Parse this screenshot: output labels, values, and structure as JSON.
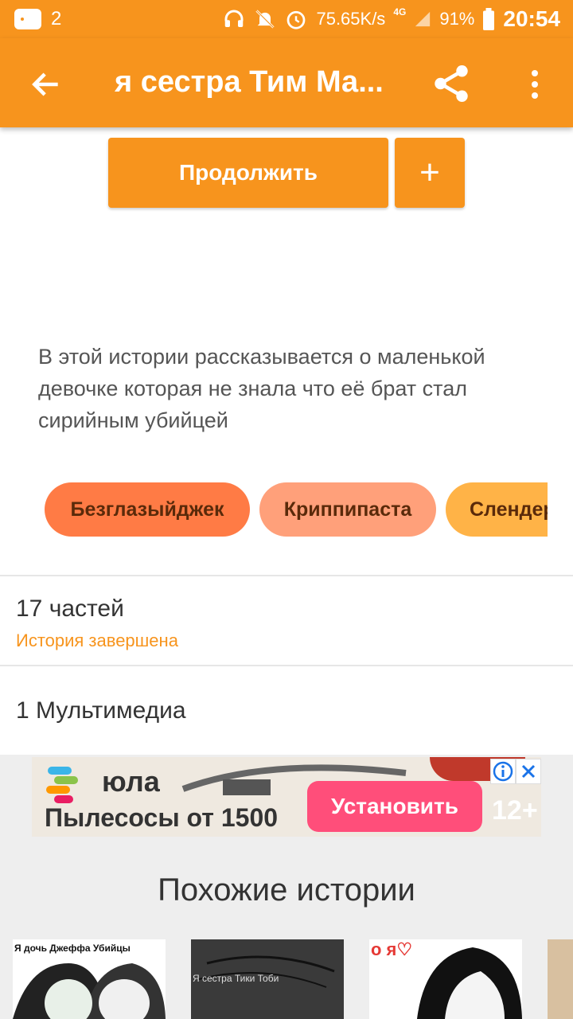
{
  "status_bar": {
    "notification_count": "2",
    "network_speed": "75.65K/s",
    "network_type": "4G",
    "battery": "91%",
    "time": "20:54"
  },
  "app_bar": {
    "title": "я сестра Тим Ма...",
    "back_icon": "arrow-back-icon",
    "share_icon": "share-icon",
    "more_icon": "more-vert-icon"
  },
  "actions": {
    "continue_label": "Продолжить",
    "add_label": "+"
  },
  "description": "В этой истории рассказывается о маленькой девочке которая не знала что её брат стал сирийным убийцей",
  "tags": [
    "Безглазыйджек",
    "Криппипаста",
    "Слендерм"
  ],
  "info": {
    "parts": "17 частей",
    "status": "История завершена",
    "media": "1 Мультимедиа"
  },
  "ad": {
    "brand": "юла",
    "text": "Пылесосы от 1500",
    "install_label": "Установить",
    "age": "12+",
    "info_icon": "info-icon",
    "close_icon": "close-icon"
  },
  "similar": {
    "heading": "Похожие истории",
    "cards": [
      {
        "caption": "Я дочь Джеффа Убийцы"
      },
      {
        "caption": "Я сестра Тики Тоби"
      },
      {
        "caption": "о я♡"
      },
      {
        "caption": ""
      }
    ]
  },
  "colors": {
    "primary": "#f7941d",
    "tag1": "#ff7b45",
    "tag2": "#ffa07a",
    "tag3": "#ffb347",
    "ad_button": "#ff4e7a"
  }
}
